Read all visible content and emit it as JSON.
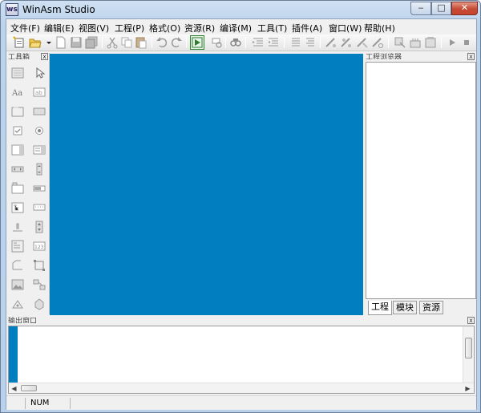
{
  "window": {
    "title": "WinAsm Studio",
    "app_icon_text": "ws"
  },
  "caption_buttons": {
    "minimize": "‒",
    "maximize": "□",
    "close": "✕"
  },
  "menubar": {
    "items": [
      {
        "label": "文件(F)"
      },
      {
        "label": "编辑(E)"
      },
      {
        "label": "视图(V)"
      },
      {
        "label": "工程(P)"
      },
      {
        "label": "格式(O)"
      },
      {
        "label": "资源(R)"
      },
      {
        "label": "编译(M)"
      },
      {
        "label": "工具(T)"
      },
      {
        "label": "插件(A)"
      },
      {
        "label": "窗口(W)"
      },
      {
        "label": "帮助(H)"
      }
    ]
  },
  "toolbar": {
    "icons": [
      "new-project-icon",
      "open-project-icon",
      "dropdown-arrow-icon",
      "new-file-icon",
      "save-icon",
      "save-all-icon",
      "cut-icon",
      "copy-icon",
      "paste-icon",
      "undo-icon",
      "redo-icon",
      "run-icon",
      "find-icon",
      "find-next-icon",
      "indent-icon",
      "outdent-icon",
      "comment-icon",
      "uncomment-icon",
      "assemble-icon",
      "link-icon",
      "build-icon",
      "dialog-icon",
      "resource-icon",
      "rc-icon",
      "start-icon",
      "stop-icon"
    ]
  },
  "toolbox": {
    "caption": "工具箱",
    "close": "x"
  },
  "project_explorer": {
    "caption": "工程浏览器",
    "close": "x",
    "tabs": [
      {
        "label": "工程"
      },
      {
        "label": "模块"
      },
      {
        "label": "资源"
      }
    ]
  },
  "output": {
    "caption": "输出窗口",
    "close": "x"
  },
  "statusbar": {
    "num": "NUM"
  },
  "colors": {
    "editor_bg": "#017ebf",
    "accent": "#2e7d32"
  }
}
